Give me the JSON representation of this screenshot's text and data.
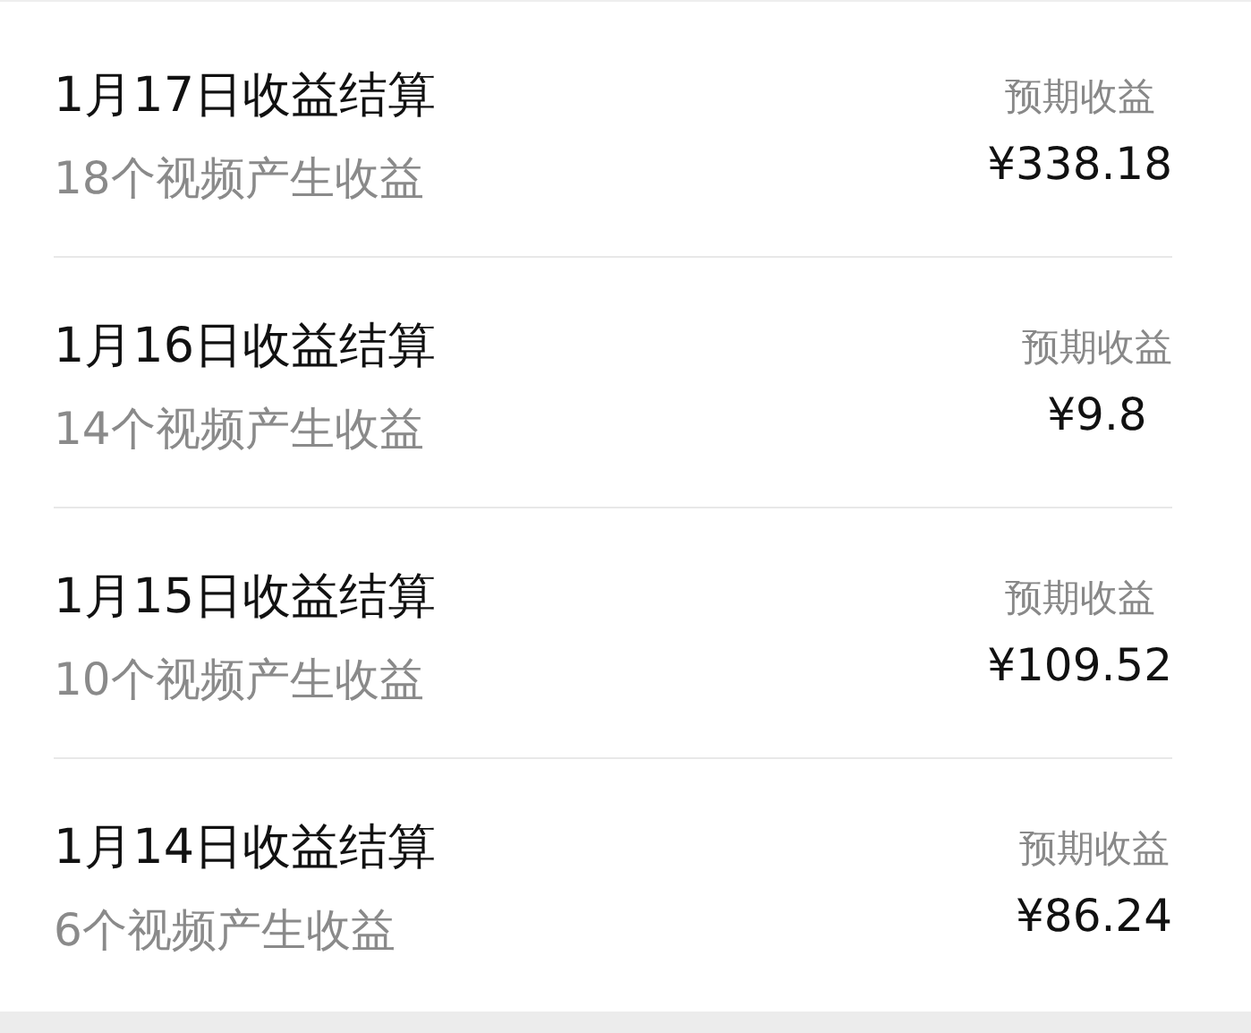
{
  "settlements": [
    {
      "title": "1月17日收益结算",
      "subtitle": "18个视频产生收益",
      "label": "预期收益",
      "amount": "¥338.18"
    },
    {
      "title": "1月16日收益结算",
      "subtitle": "14个视频产生收益",
      "label": "预期收益",
      "amount": "¥9.8"
    },
    {
      "title": "1月15日收益结算",
      "subtitle": "10个视频产生收益",
      "label": "预期收益",
      "amount": "¥109.52"
    },
    {
      "title": "1月14日收益结算",
      "subtitle": "6个视频产生收益",
      "label": "预期收益",
      "amount": "¥86.24"
    }
  ]
}
